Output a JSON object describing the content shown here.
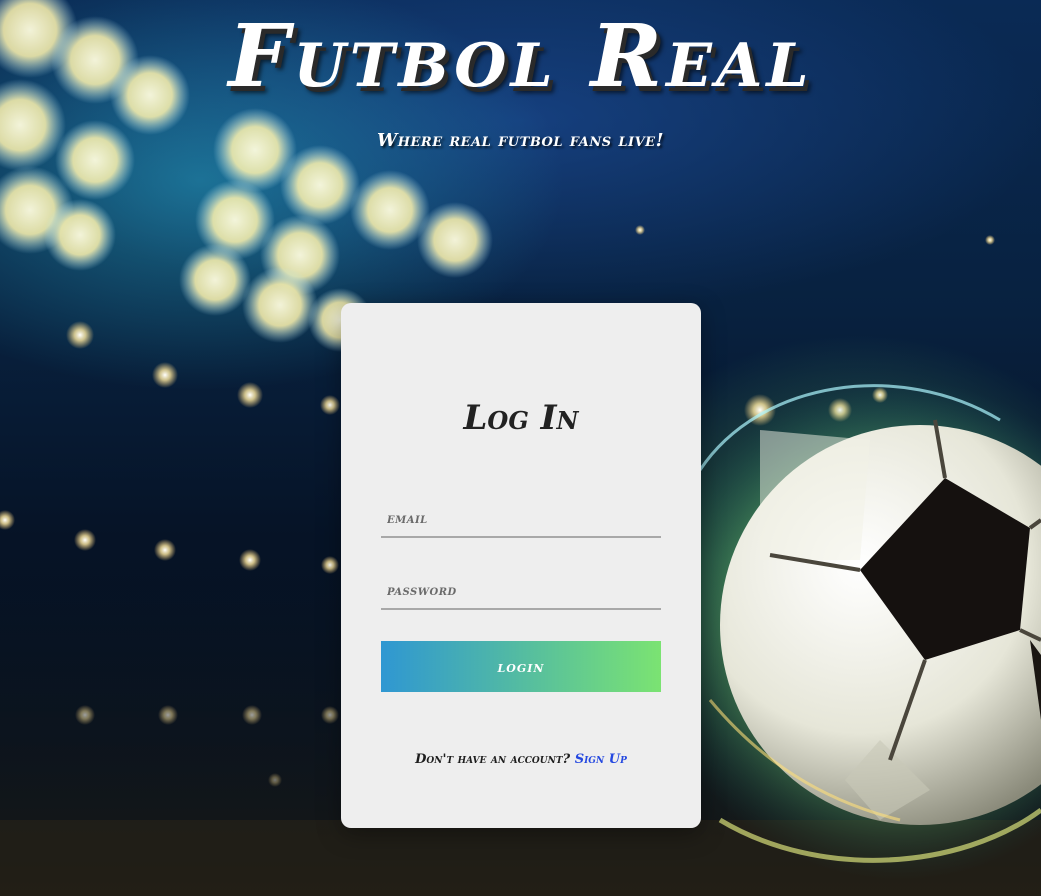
{
  "header": {
    "title": "Futbol Real",
    "tagline": "Where real futbol fans live!"
  },
  "login": {
    "heading": "Log In",
    "email": {
      "placeholder": "email",
      "value": ""
    },
    "password": {
      "placeholder": "password",
      "value": ""
    },
    "submit_label": "login",
    "signup_prompt": "Don't have an account?",
    "signup_link": "Sign Up"
  },
  "colors": {
    "card_background": "#eeeeee",
    "button_gradient_start": "#2f97d2",
    "button_gradient_end": "#7be372",
    "link": "#2448e0",
    "title_text": "#ffffff"
  },
  "icons": {
    "background": "stadium-lights-soccer-ball-image"
  }
}
